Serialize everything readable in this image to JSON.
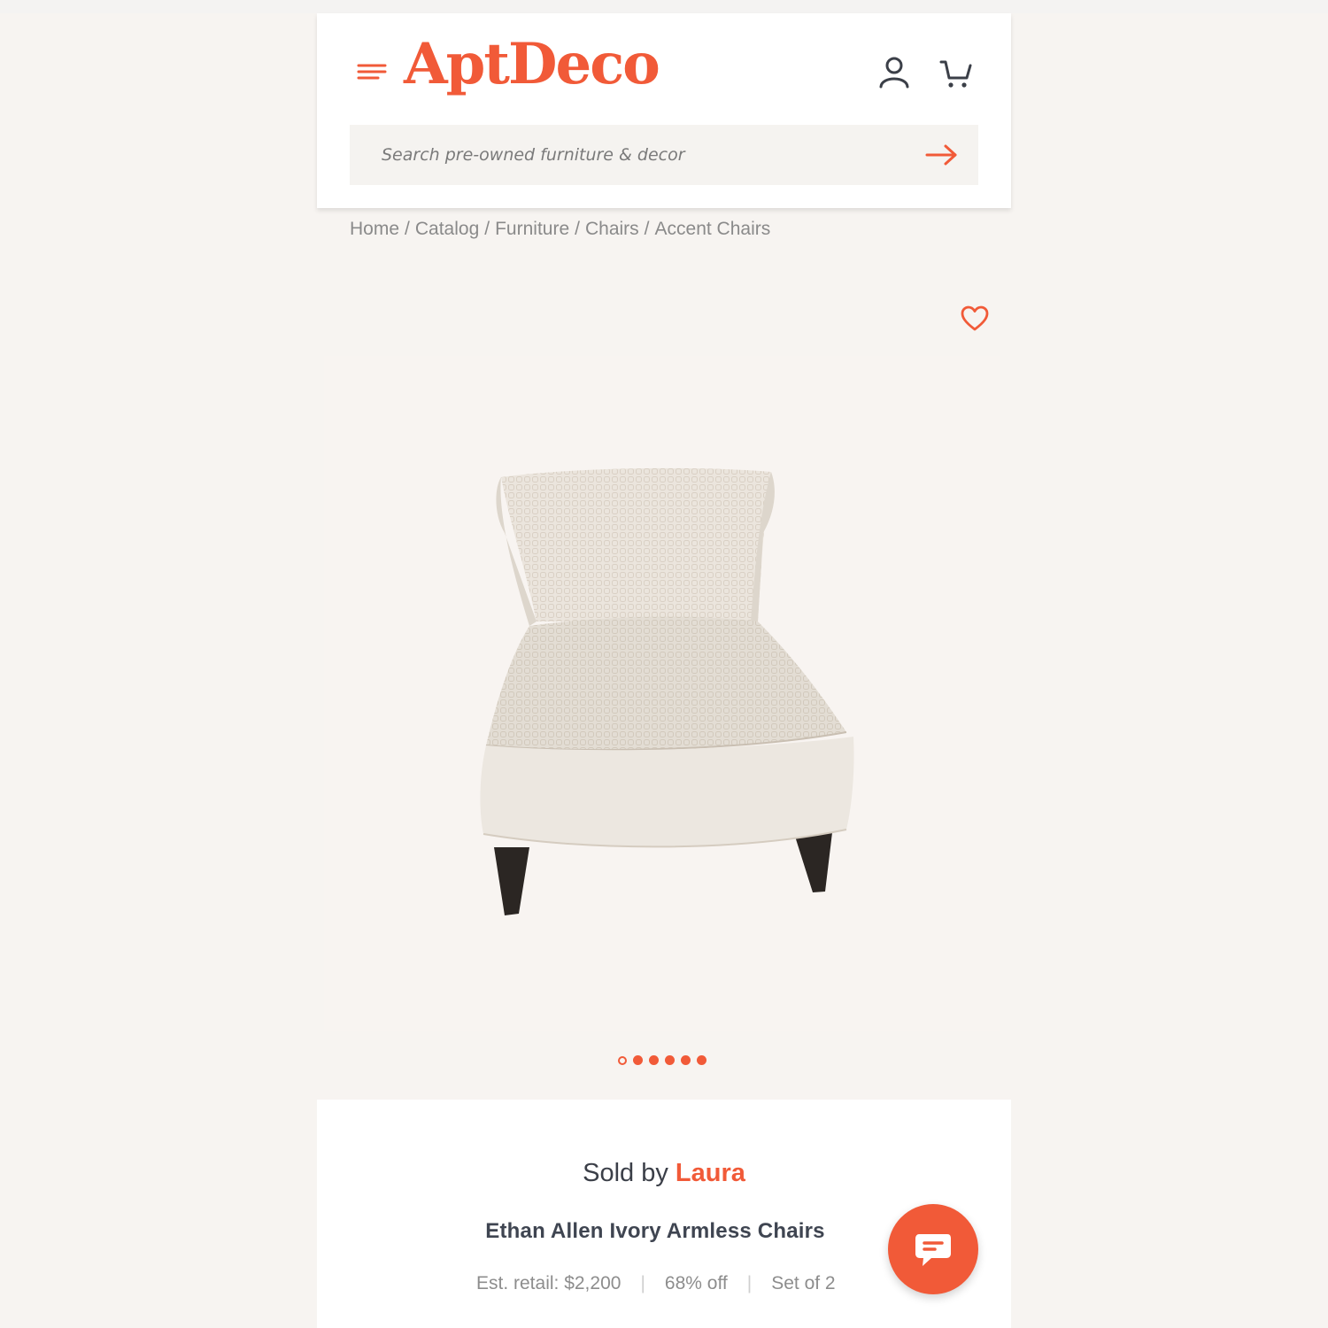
{
  "brand": {
    "logo_text": "AptDeco",
    "accent_color": "#f15a38"
  },
  "header": {
    "menu_icon": "hamburger-menu-icon",
    "account_icon": "user-account-icon",
    "cart_icon": "shopping-cart-icon"
  },
  "search": {
    "placeholder": "Search pre-owned furniture & decor",
    "value": "",
    "submit_icon": "arrow-right-icon"
  },
  "breadcrumb": {
    "items": [
      "Home",
      "Catalog",
      "Furniture",
      "Chairs",
      "Accent Chairs"
    ],
    "separator": "/"
  },
  "favorite_icon": "heart-outline-icon",
  "gallery": {
    "image_label": "ivory armless accent chair",
    "total_images": 6,
    "active_index": 0
  },
  "product": {
    "sold_by_label": "Sold by",
    "seller_name": "Laura",
    "title": "Ethan Allen Ivory Armless Chairs",
    "est_retail": "Est. retail: $2,200",
    "discount": "68% off",
    "set_info": "Set of 2"
  },
  "chat": {
    "icon": "chat-bubble-icon"
  }
}
